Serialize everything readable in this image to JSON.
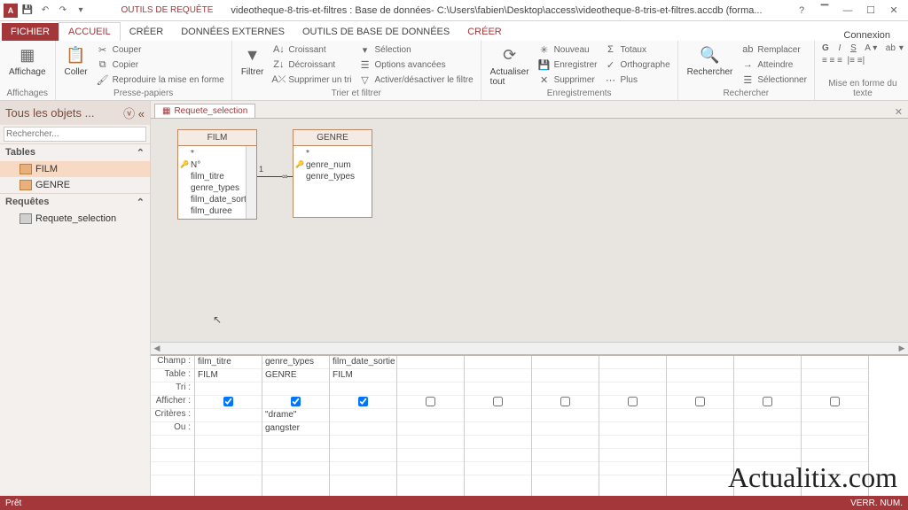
{
  "titlebar": {
    "app_icon_text": "A",
    "title": "videotheque-8-tris-et-filtres : Base de données- C:\\Users\\fabien\\Desktop\\access\\videotheque-8-tris-et-filtres.accdb (forma...",
    "contextual_label": "OUTILS DE REQUÊTE"
  },
  "tabs": {
    "file": "FICHIER",
    "home": "ACCUEIL",
    "create": "CRÉER",
    "external": "DONNÉES EXTERNES",
    "dbtools": "OUTILS DE BASE DE DONNÉES",
    "contextual_create": "CRÉER",
    "connexion": "Connexion"
  },
  "ribbon": {
    "views": {
      "label": "Affichages",
      "view_btn": "Affichage"
    },
    "clipboard": {
      "label": "Presse-papiers",
      "paste": "Coller",
      "cut": "Couper",
      "copy": "Copier",
      "format": "Reproduire la mise en forme"
    },
    "sortfilter": {
      "label": "Trier et filtrer",
      "filter": "Filtrer",
      "asc": "Croissant",
      "desc": "Décroissant",
      "remove": "Supprimer un tri",
      "selection": "Sélection",
      "advanced": "Options avancées",
      "toggle": "Activer/désactiver le filtre"
    },
    "records": {
      "label": "Enregistrements",
      "refresh": "Actualiser tout",
      "new": "Nouveau",
      "save": "Enregistrer",
      "delete": "Supprimer",
      "totals": "Totaux",
      "spelling": "Orthographe",
      "more": "Plus"
    },
    "find": {
      "label": "Rechercher",
      "find_btn": "Rechercher",
      "replace": "Remplacer",
      "goto": "Atteindre",
      "select": "Sélectionner"
    },
    "textfmt": {
      "label": "Mise en forme du texte"
    }
  },
  "nav": {
    "header": "Tous les objets ...",
    "search_placeholder": "Rechercher...",
    "tables_group": "Tables",
    "table_film": "FILM",
    "table_genre": "GENRE",
    "queries_group": "Requêtes",
    "query1": "Requete_selection"
  },
  "doc": {
    "tab_name": "Requete_selection",
    "film_box": {
      "title": "FILM",
      "star": "*",
      "fields": [
        "N°",
        "film_titre",
        "genre_types",
        "film_date_sortie",
        "film_duree"
      ]
    },
    "genre_box": {
      "title": "GENRE",
      "star": "*",
      "fields": [
        "genre_num",
        "genre_types"
      ]
    },
    "join_left": "1",
    "join_right": "∞"
  },
  "grid": {
    "labels": {
      "champ": "Champ :",
      "table": "Table :",
      "tri": "Tri :",
      "afficher": "Afficher :",
      "criteres": "Critères :",
      "ou": "Ou :"
    },
    "cols": [
      {
        "champ": "film_titre",
        "table": "FILM",
        "afficher": true,
        "crit": "",
        "ou": ""
      },
      {
        "champ": "genre_types",
        "table": "GENRE",
        "afficher": true,
        "crit": "\"drame\"",
        "ou": "gangster"
      },
      {
        "champ": "film_date_sortie",
        "table": "FILM",
        "afficher": true,
        "crit": "",
        "ou": ""
      },
      {
        "champ": "",
        "table": "",
        "afficher": false,
        "crit": "",
        "ou": ""
      },
      {
        "champ": "",
        "table": "",
        "afficher": false,
        "crit": "",
        "ou": ""
      },
      {
        "champ": "",
        "table": "",
        "afficher": false,
        "crit": "",
        "ou": ""
      },
      {
        "champ": "",
        "table": "",
        "afficher": false,
        "crit": "",
        "ou": ""
      },
      {
        "champ": "",
        "table": "",
        "afficher": false,
        "crit": "",
        "ou": ""
      },
      {
        "champ": "",
        "table": "",
        "afficher": false,
        "crit": "",
        "ou": ""
      },
      {
        "champ": "",
        "table": "",
        "afficher": false,
        "crit": "",
        "ou": ""
      }
    ]
  },
  "statusbar": {
    "left": "Prêt",
    "right": "VERR. NUM."
  },
  "watermark": "Actualitix.com"
}
